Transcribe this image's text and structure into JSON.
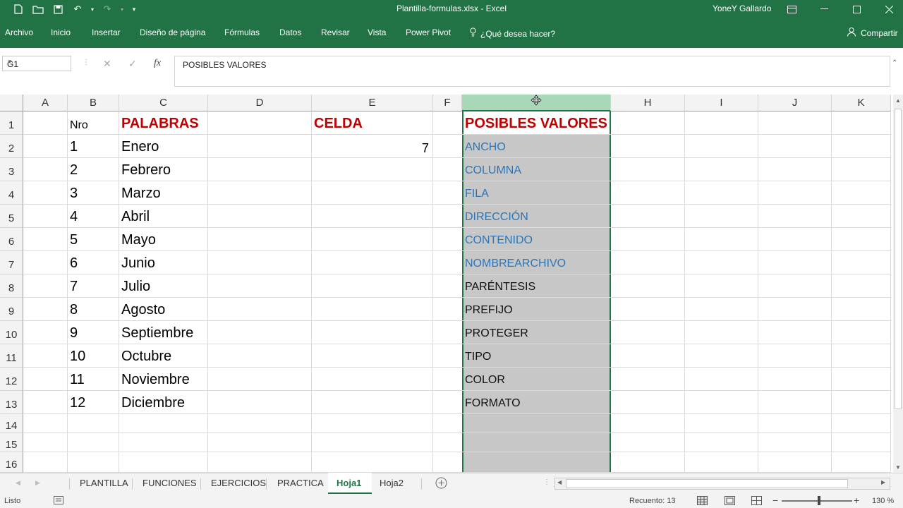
{
  "titlebar": {
    "title": "Plantilla-formulas.xlsx  -  Excel",
    "user": "YoneY Gallardo"
  },
  "ribbon": {
    "tabs": [
      "Archivo",
      "Inicio",
      "Insertar",
      "Diseño de página",
      "Fórmulas",
      "Datos",
      "Revisar",
      "Vista",
      "Power Pivot"
    ],
    "tell_me": "¿Qué desea hacer?",
    "share": "Compartir"
  },
  "formula_bar": {
    "name_box": "G1",
    "fx": "fx",
    "content": "POSIBLES VALORES"
  },
  "columns": [
    "A",
    "B",
    "C",
    "D",
    "E",
    "F",
    "G",
    "H",
    "I",
    "J",
    "K"
  ],
  "selected_column": "G",
  "rows": [
    "1",
    "2",
    "3",
    "4",
    "5",
    "6",
    "7",
    "8",
    "9",
    "10",
    "11",
    "12",
    "13",
    "14",
    "15",
    "16"
  ],
  "headers": {
    "b": "Nro",
    "c": "PALABRAS",
    "e": "CELDA",
    "g": "POSIBLES VALORES"
  },
  "cells_b": [
    "1",
    "2",
    "3",
    "4",
    "5",
    "6",
    "7",
    "8",
    "9",
    "10",
    "11",
    "12"
  ],
  "cells_c": [
    "Enero",
    "Febrero",
    "Marzo",
    "Abril",
    "Mayo",
    "Junio",
    "Julio",
    "Agosto",
    "Septiembre",
    "Octubre",
    "Noviembre",
    "Diciembre"
  ],
  "cell_e2": "7",
  "cells_g": [
    "ANCHO",
    "COLUMNA",
    "FILA",
    "DIRECCIÓN",
    "CONTENIDO",
    "NOMBREARCHIVO",
    "PARÉNTESIS",
    "PREFIJO",
    "PROTEGER",
    "TIPO",
    "COLOR",
    "FORMATO"
  ],
  "sheets": [
    "PLANTILLA",
    "FUNCIONES",
    "EJERCICIOS",
    "PRACTICA",
    "Hoja1",
    "Hoja2"
  ],
  "active_sheet": "Hoja1",
  "status": {
    "ready": "Listo",
    "count": "Recuento: 13",
    "zoom": "130 %"
  },
  "colors": {
    "excel_green": "#217346",
    "header_red": "#c00000",
    "link_blue": "#2e75b6",
    "selection_gray": "#c7c7c7"
  }
}
